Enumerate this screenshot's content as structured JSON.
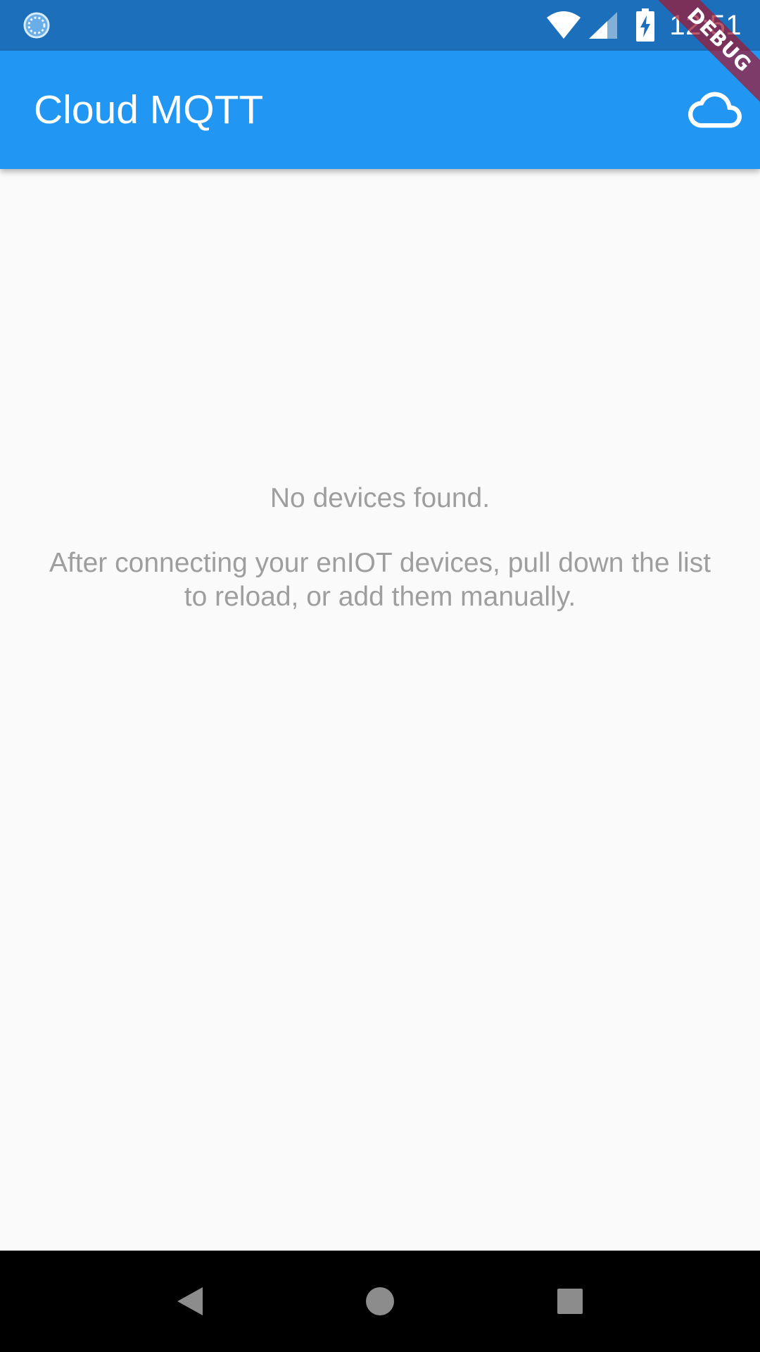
{
  "status_bar": {
    "time": "12:51",
    "app_icon": "loading-spinner-icon",
    "icons": [
      "wifi-icon",
      "cell-signal-icon",
      "battery-charging-icon"
    ],
    "background_color": "#1c6fba"
  },
  "app_bar": {
    "title": "Cloud MQTT",
    "action_icon": "cloud-icon",
    "background_color": "#2196f3"
  },
  "debug_banner": {
    "label": "DEBUG"
  },
  "empty_state": {
    "title": "No devices found.",
    "message": "After connecting your enIOT devices, pull down the list to reload, or add them manually.",
    "text_color": "#9e9e9e"
  },
  "navigation_bar": {
    "buttons": [
      "back-icon",
      "home-icon",
      "recents-icon"
    ]
  }
}
